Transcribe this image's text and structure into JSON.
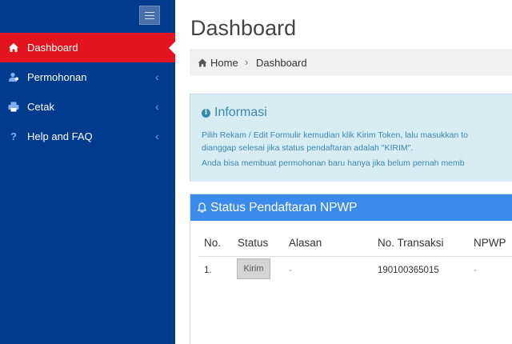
{
  "sidebar": {
    "items": [
      {
        "label": "Dashboard",
        "icon": "home-icon",
        "active": true
      },
      {
        "label": "Permohonan",
        "icon": "users-icon",
        "active": false
      },
      {
        "label": "Cetak",
        "icon": "print-icon",
        "active": false
      },
      {
        "label": "Help and FAQ",
        "icon": "question-icon",
        "active": false
      }
    ],
    "chevron": "‹",
    "colors": {
      "background": "#003b8e",
      "active": "#e2141f"
    }
  },
  "header": {
    "title": "Dashboard"
  },
  "breadcrumb": {
    "home": "Home",
    "separator": "›",
    "current": "Dashboard"
  },
  "info": {
    "title": "Informasi",
    "line1": "Pilih Rekam / Edit Formulir kemudian klik Kirim Token, lalu masukkan to",
    "line2": "dianggap selesai jika status pendaftaran adalah \"KIRIM\".",
    "line3": "Anda bisa membuat permohonan baru hanya jika belum pernah memb"
  },
  "status_panel": {
    "title": "Status Pendaftaran NPWP",
    "columns": [
      "No.",
      "Status",
      "Alasan",
      "No. Transaksi",
      "NPWP"
    ],
    "rows": [
      {
        "no": "1.",
        "status": "Kirim",
        "alasan": "-",
        "no_transaksi": "190100365015",
        "npwp": "-"
      }
    ]
  }
}
